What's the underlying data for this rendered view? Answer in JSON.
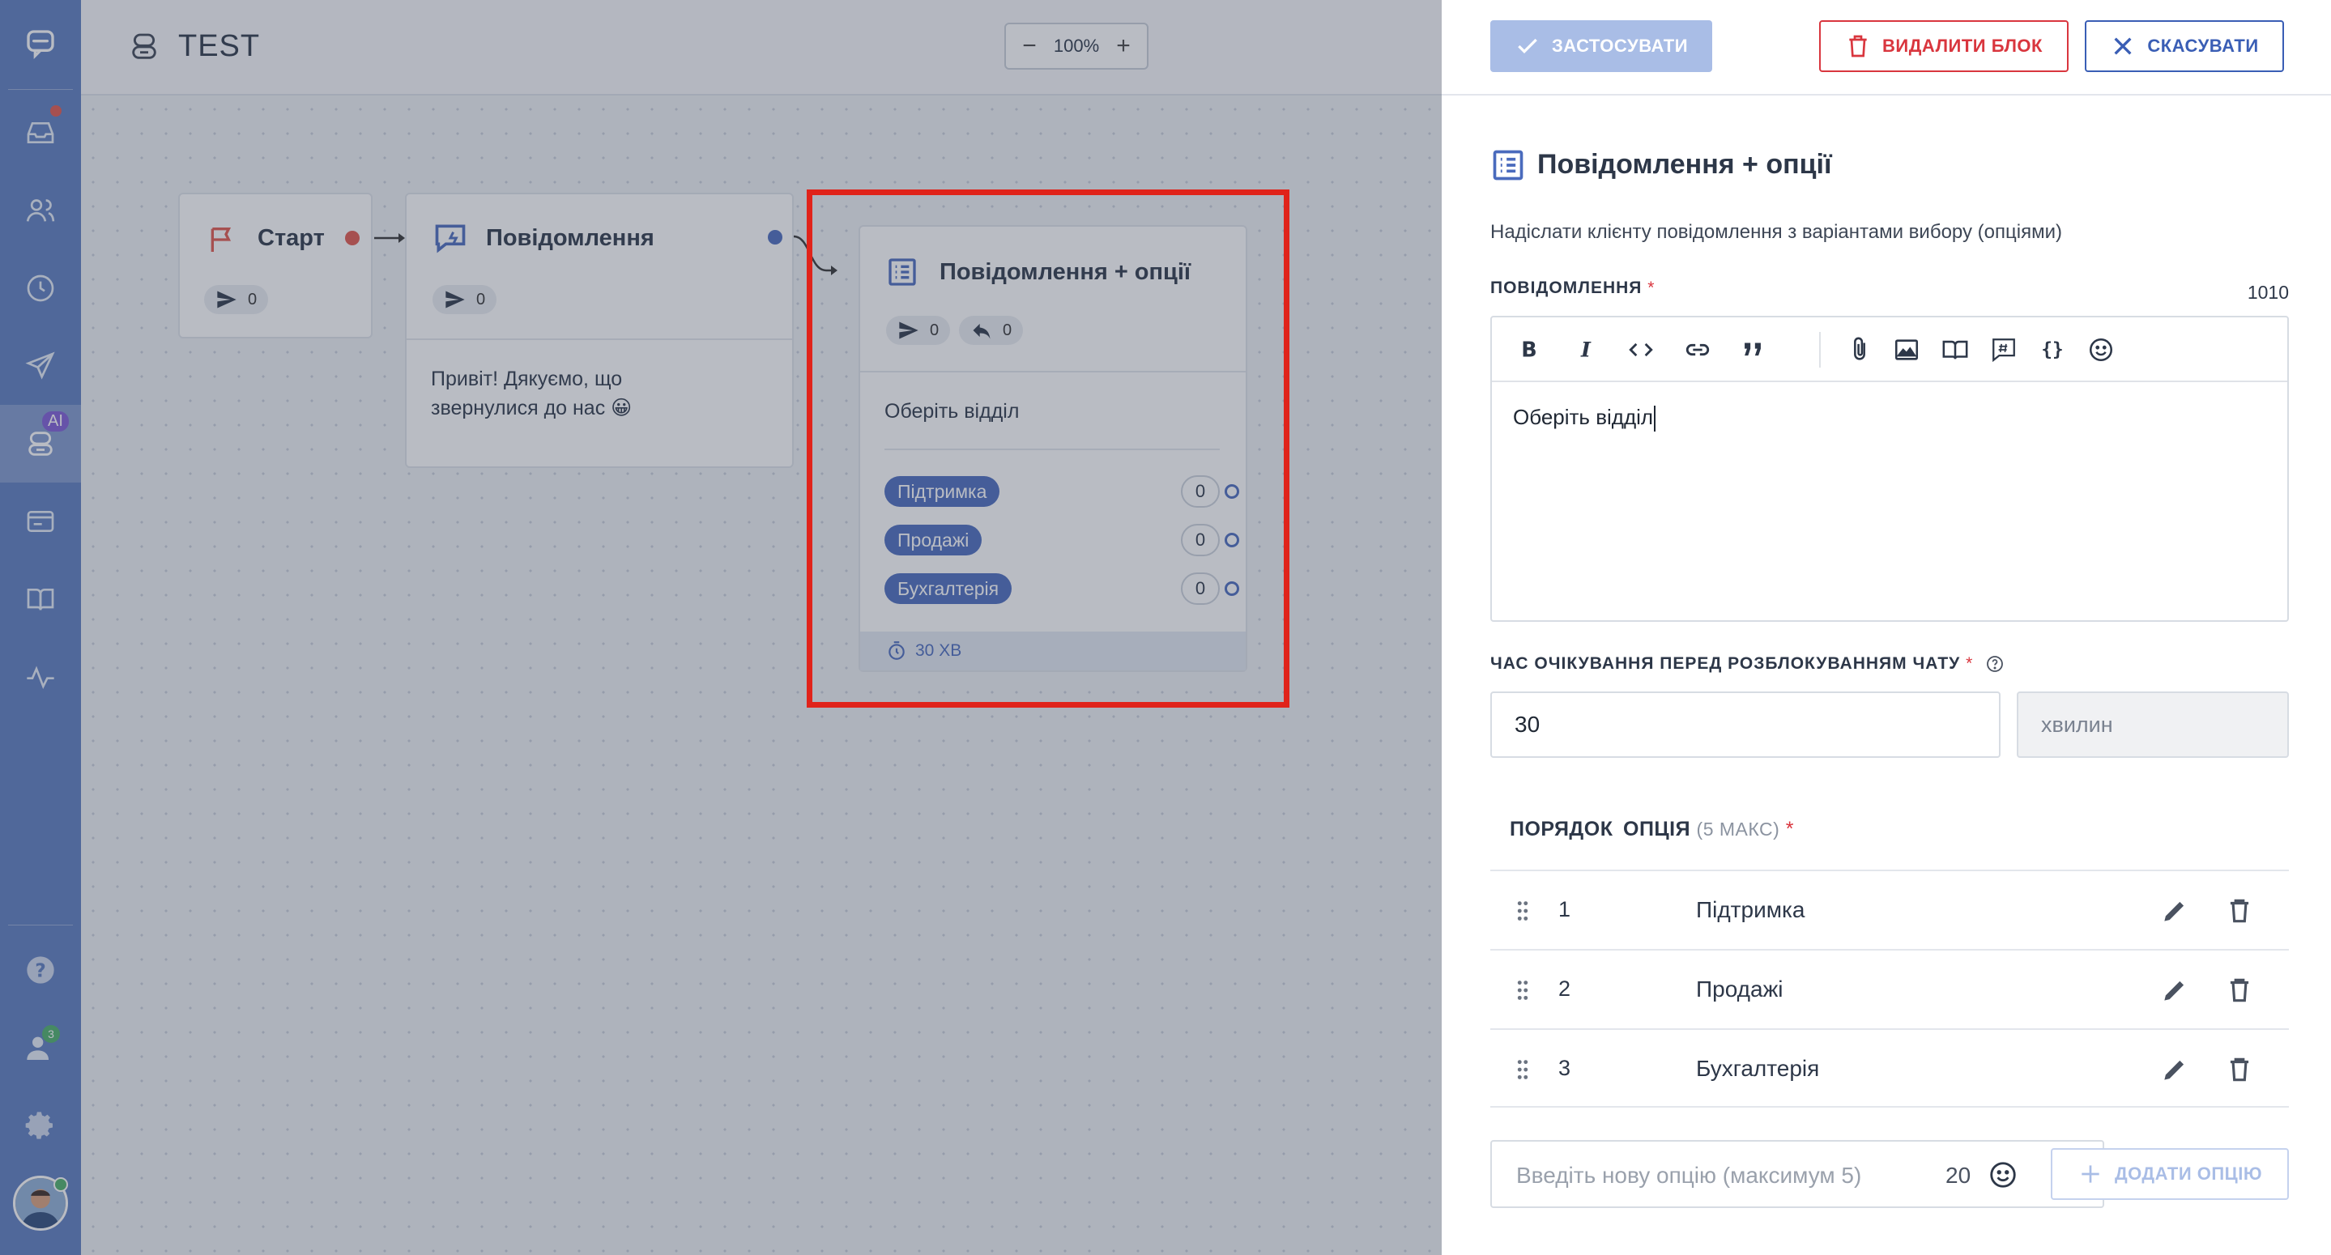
{
  "app": {
    "flow_title": "TEST",
    "zoom_level": "100%",
    "zoom_minus": "−",
    "zoom_plus": "+",
    "sidebar_ai_badge": "AI",
    "sidebar_notification_count": "3"
  },
  "canvas": {
    "start_block": {
      "title": "Старт",
      "sent_count": "0"
    },
    "message_block": {
      "title": "Повідомлення",
      "sent_count": "0",
      "text": "Привіт! Дякуємо, що звернулися до нас 😀"
    },
    "options_block": {
      "title": "Повідомлення + опції",
      "sent_count": "0",
      "reply_count": "0",
      "text": "Оберіть відділ",
      "options": [
        {
          "label": "Підтримка",
          "count": "0"
        },
        {
          "label": "Продажі",
          "count": "0"
        },
        {
          "label": "Бухгалтерія",
          "count": "0"
        }
      ],
      "timer": "30 ХВ"
    }
  },
  "panel": {
    "apply_label": "ЗАСТОСУВАТИ",
    "delete_label": "ВИДАЛИТИ БЛОК",
    "cancel_label": "СКАСУВАТИ",
    "title": "Повідомлення + опції",
    "description": "Надіслати клієнту повідомлення з варіантами вибору (опціями)",
    "message_label": "ПОВІДОМЛЕННЯ",
    "required_mark": "*",
    "char_counter": "1010",
    "message_text": "Оберіть відділ",
    "timeout_label": "ЧАС ОЧІКУВАННЯ ПЕРЕД РОЗБЛОКУВАННЯМ ЧАТУ",
    "timeout_value": "30",
    "timeout_unit": "хвилин",
    "order_header": "ПОРЯДОК",
    "option_header": "ОПЦІЯ",
    "option_header_note": "(5 МАКС)",
    "options": [
      {
        "order": "1",
        "label": "Підтримка"
      },
      {
        "order": "2",
        "label": "Продажі"
      },
      {
        "order": "3",
        "label": "Бухгалтерія"
      }
    ],
    "new_option_placeholder": "Введіть нову опцію (максимум 5)",
    "new_option_counter": "20",
    "add_option_label": "ДОДАТИ ОПЦІЮ"
  },
  "colors": {
    "sidebar": "#5c7cbf",
    "accent_blue": "#4a6bbd",
    "danger_red": "#d9363e",
    "highlight_red": "#e0231a"
  }
}
